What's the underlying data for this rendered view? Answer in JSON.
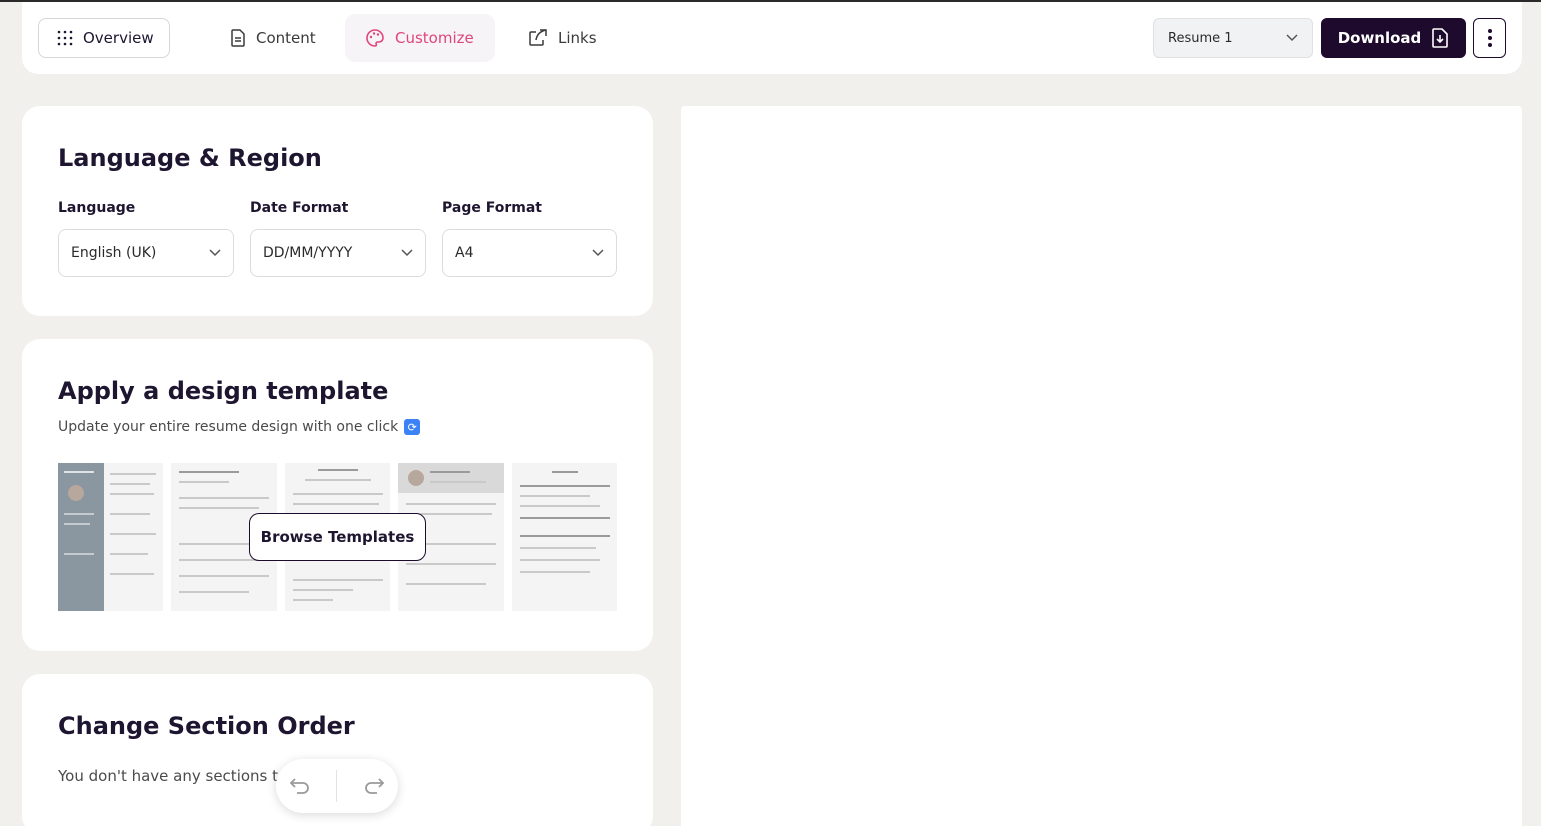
{
  "topbar": {
    "overview_label": "Overview",
    "tabs": [
      {
        "label": "Content",
        "icon": "document-icon"
      },
      {
        "label": "Customize",
        "icon": "palette-icon",
        "active": true
      },
      {
        "label": "Links",
        "icon": "share-icon"
      }
    ],
    "resume_select": "Resume 1",
    "download_label": "Download"
  },
  "language_region": {
    "title": "Language & Region",
    "fields": [
      {
        "label": "Language",
        "value": "English (UK)"
      },
      {
        "label": "Date Format",
        "value": "DD/MM/YYYY"
      },
      {
        "label": "Page Format",
        "value": "A4"
      }
    ]
  },
  "design_template": {
    "title": "Apply a design template",
    "subtitle": "Update your entire resume design with one click",
    "browse_label": "Browse Templates"
  },
  "section_order": {
    "title": "Change Section Order",
    "text": "You don't have any sections to"
  },
  "colors": {
    "accent": "#e0457b",
    "primary_dark": "#1e0a2c",
    "background": "#f1f0ec"
  }
}
